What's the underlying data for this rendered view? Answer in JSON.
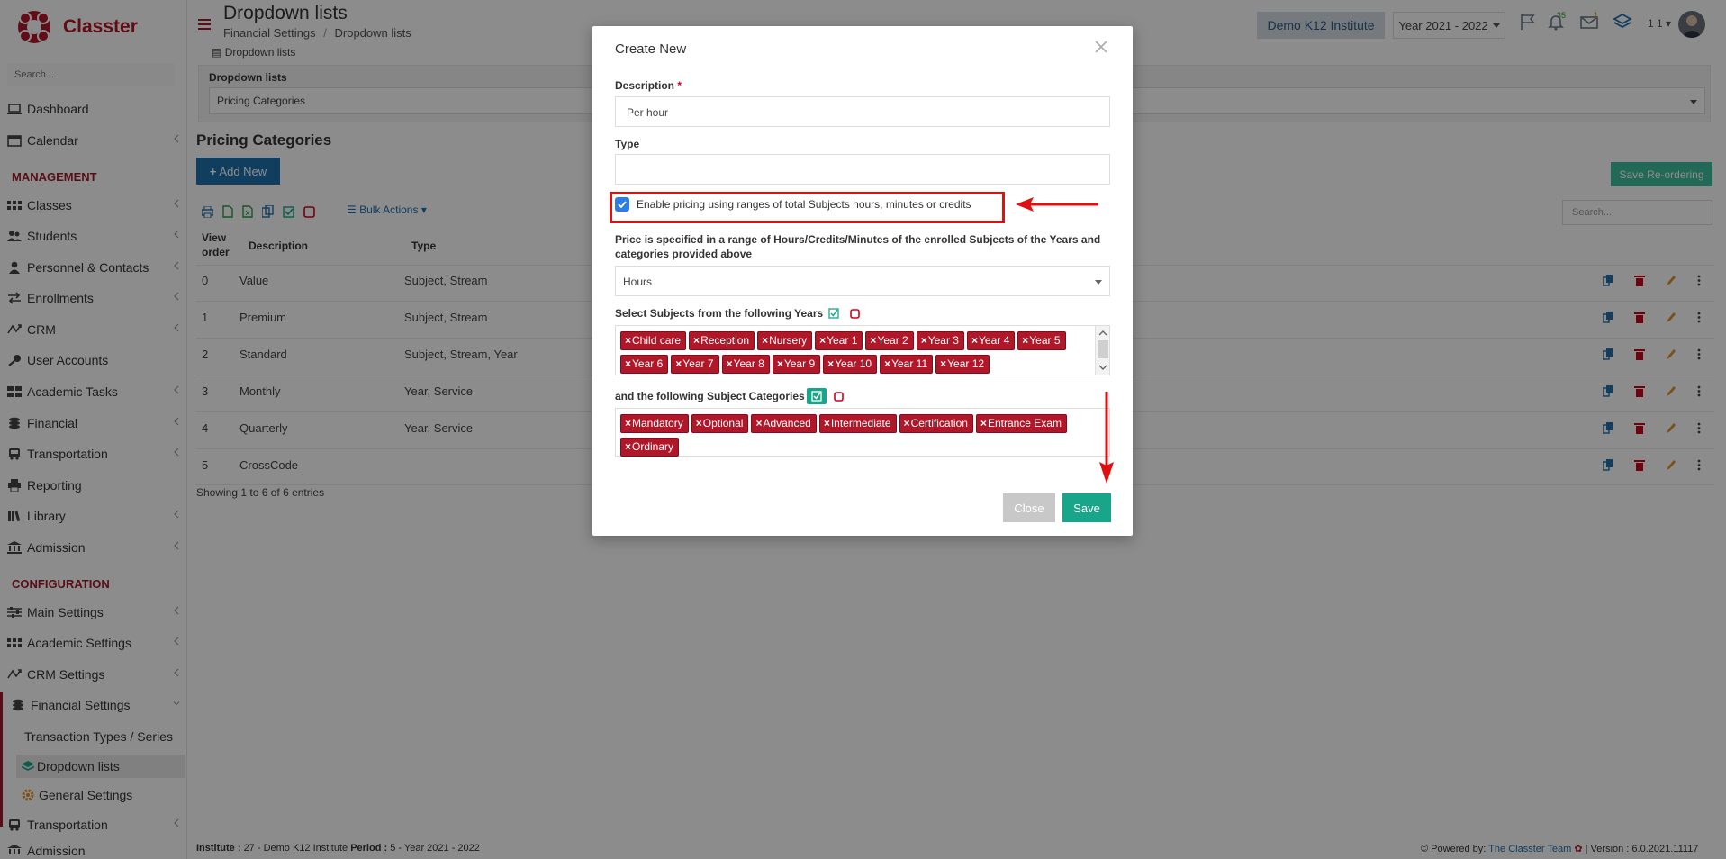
{
  "app": {
    "name": "Classter",
    "search_placeholder": "Search..."
  },
  "header": {
    "title": "Dropdown lists",
    "breadcrumb": [
      "Financial Settings",
      "/",
      "Dropdown lists"
    ],
    "institute": "Demo K12 Institute",
    "year": "Year 2021 - 2022",
    "notif_count": "35",
    "msg_count": "1",
    "user_num": "1 1"
  },
  "sidebar": {
    "items": [
      {
        "label": "Dashboard"
      },
      {
        "label": "Calendar"
      }
    ],
    "management_heading": "MANAGEMENT",
    "management": [
      {
        "label": "Classes"
      },
      {
        "label": "Students"
      },
      {
        "label": "Personnel & Contacts"
      },
      {
        "label": "Enrollments"
      },
      {
        "label": "CRM"
      },
      {
        "label": "User Accounts"
      },
      {
        "label": "Academic Tasks"
      },
      {
        "label": "Financial"
      },
      {
        "label": "Transportation"
      },
      {
        "label": "Reporting"
      },
      {
        "label": "Library"
      },
      {
        "label": "Admission"
      }
    ],
    "configuration_heading": "CONFIGURATION",
    "configuration": [
      {
        "label": "Main Settings"
      },
      {
        "label": "Academic Settings"
      },
      {
        "label": "CRM Settings"
      },
      {
        "label": "Financial Settings"
      }
    ],
    "financial_sub": [
      {
        "label": "Transaction Types / Series"
      },
      {
        "label": "Dropdown lists"
      },
      {
        "label": "General Settings"
      }
    ],
    "after": [
      {
        "label": "Transportation"
      },
      {
        "label": "Admission"
      }
    ]
  },
  "content": {
    "tab_label": "Dropdown lists",
    "dropdown_label": "Dropdown lists",
    "dropdown_value": "Pricing Categories",
    "section_title": "Pricing Categories",
    "add_new": "Add New",
    "save_reordering": "Save Re-ordering",
    "bulk_actions": "Bulk Actions",
    "search_placeholder": "Search...",
    "columns": [
      "View order",
      "Description",
      "Type"
    ],
    "rows": [
      {
        "order": "0",
        "description": "Value",
        "type": "Subject, Stream"
      },
      {
        "order": "1",
        "description": "Premium",
        "type": "Subject, Stream"
      },
      {
        "order": "2",
        "description": "Standard",
        "type": "Subject, Stream, Year"
      },
      {
        "order": "3",
        "description": "Monthly",
        "type": "Year, Service"
      },
      {
        "order": "4",
        "description": "Quarterly",
        "type": "Year, Service"
      },
      {
        "order": "5",
        "description": "CrossCode",
        "type": ""
      }
    ],
    "showing": "Showing 1 to 6 of 6 entries"
  },
  "footer": {
    "left_institute_label": "Institute :",
    "left_institute": "27 - Demo K12 Institute",
    "left_period_label": "Period :",
    "left_period": "5 - Year 2021 - 2022",
    "powered_by": "Powered by:",
    "team": "The Classter Team",
    "version": "| Version : 6.0.2021.11117"
  },
  "modal": {
    "title": "Create New",
    "description_label": "Description",
    "required_mark": "*",
    "description_value": "Per hour",
    "type_label": "Type",
    "type_value": "",
    "enable_label": "Enable pricing using ranges of total Subjects hours, minutes or credits",
    "enable_checked": true,
    "price_label": "Price is specified in a range of Hours/Credits/Minutes of the enrolled Subjects of the Years and categories provided above",
    "price_unit": "Hours",
    "years_label": "Select Subjects from the following Years",
    "years": [
      "Child care",
      "Reception",
      "Nursery",
      "Year 1",
      "Year 2",
      "Year 3",
      "Year 4",
      "Year 5",
      "Year 6",
      "Year 7",
      "Year 8",
      "Year 9",
      "Year 10",
      "Year 11",
      "Year 12"
    ],
    "categories_label": "and the following Subject Categories",
    "categories": [
      "Mandatory",
      "Optional",
      "Advanced",
      "Intermediate",
      "Certification",
      "Entrance Exam",
      "Ordinary"
    ],
    "close_label": "Close",
    "save_label": "Save"
  },
  "colors": {
    "accent": "#b0182a",
    "primary": "#1f6fae",
    "success": "#19a58a",
    "highlight": "#e01010"
  }
}
